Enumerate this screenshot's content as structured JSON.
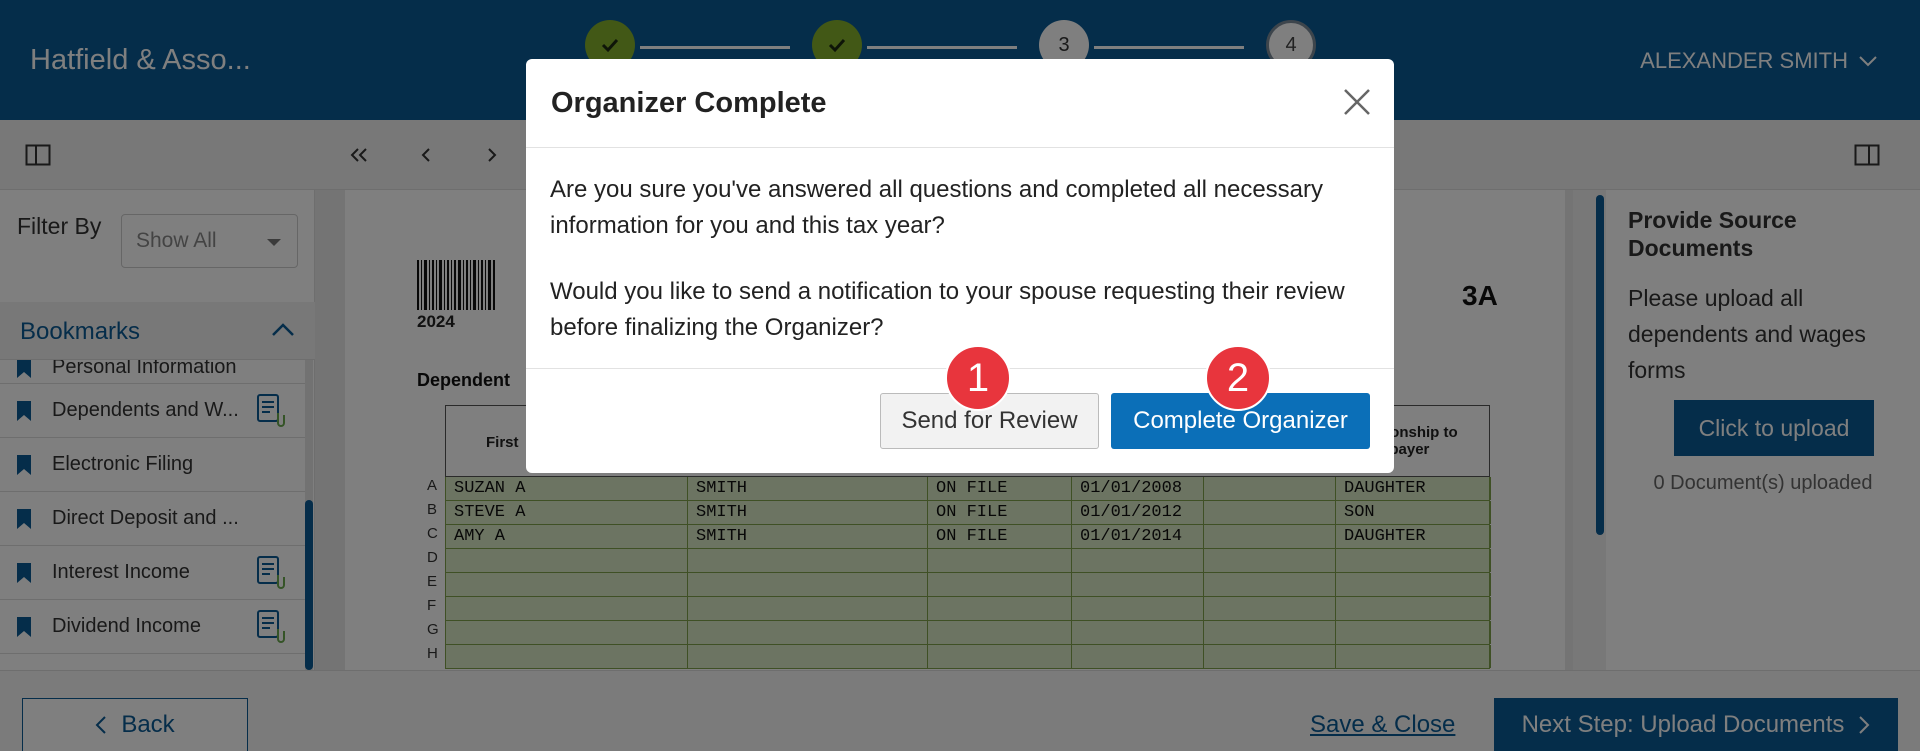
{
  "header": {
    "brand": "Hatfield & Asso...",
    "user_name": "ALEXANDER SMITH",
    "steps": [
      {
        "label": "",
        "state": "done",
        "icon": "check-icon"
      },
      {
        "label": "",
        "state": "done",
        "icon": "check-icon"
      },
      {
        "label": "3",
        "state": "current"
      },
      {
        "label": "4",
        "state": "future"
      }
    ]
  },
  "sidebar": {
    "filter_label": "Filter By",
    "filter_value": "Show All",
    "bookmarks_title": "Bookmarks",
    "items": [
      {
        "label": "Personal Information",
        "has_doc": false
      },
      {
        "label": "Dependents and W...",
        "has_doc": true
      },
      {
        "label": "Electronic Filing",
        "has_doc": false
      },
      {
        "label": "Direct Deposit and ...",
        "has_doc": false
      },
      {
        "label": "Interest Income",
        "has_doc": true
      },
      {
        "label": "Dividend Income",
        "has_doc": true
      }
    ]
  },
  "document": {
    "year": "2024",
    "form_code": "3A",
    "section_title": "Dependent",
    "col_first": "First",
    "col_relationship": "tionship to\nxpayer",
    "rows": [
      {
        "letter": "A",
        "first": "SUZAN A",
        "last": "SMITH",
        "ssn": "ON FILE",
        "dob": "01/01/2008",
        "rel": "DAUGHTER"
      },
      {
        "letter": "B",
        "first": "STEVE A",
        "last": "SMITH",
        "ssn": "ON FILE",
        "dob": "01/01/2012",
        "rel": "SON"
      },
      {
        "letter": "C",
        "first": "AMY A",
        "last": "SMITH",
        "ssn": "ON FILE",
        "dob": "01/01/2014",
        "rel": "DAUGHTER"
      },
      {
        "letter": "D",
        "first": "",
        "last": "",
        "ssn": "",
        "dob": "",
        "rel": ""
      },
      {
        "letter": "E",
        "first": "",
        "last": "",
        "ssn": "",
        "dob": "",
        "rel": ""
      },
      {
        "letter": "F",
        "first": "",
        "last": "",
        "ssn": "",
        "dob": "",
        "rel": ""
      },
      {
        "letter": "G",
        "first": "",
        "last": "",
        "ssn": "",
        "dob": "",
        "rel": ""
      },
      {
        "letter": "H",
        "first": "",
        "last": "",
        "ssn": "",
        "dob": "",
        "rel": ""
      }
    ]
  },
  "right_panel": {
    "title": "Provide Source Documents",
    "text": "Please upload all dependents and wages forms",
    "upload_label": "Click to upload",
    "count_text": "0 Document(s) uploaded"
  },
  "footer": {
    "back_label": "Back",
    "save_label": "Save & Close",
    "next_label": "Next Step: Upload Documents"
  },
  "modal": {
    "title": "Organizer Complete",
    "paragraph1": "Are you sure you've answered all questions and completed all necessary information for you and this tax year?",
    "paragraph2": "Would you like to send a notification to your spouse requesting their review before finalizing the Organizer?",
    "review_label": "Send for Review",
    "complete_label": "Complete Organizer"
  },
  "markers": [
    "1",
    "2"
  ],
  "colors": {
    "brand_blue": "#0b5a94",
    "step_done": "#84b02d",
    "marker_red": "#e8353d",
    "primary_button": "#0b6fb8"
  }
}
